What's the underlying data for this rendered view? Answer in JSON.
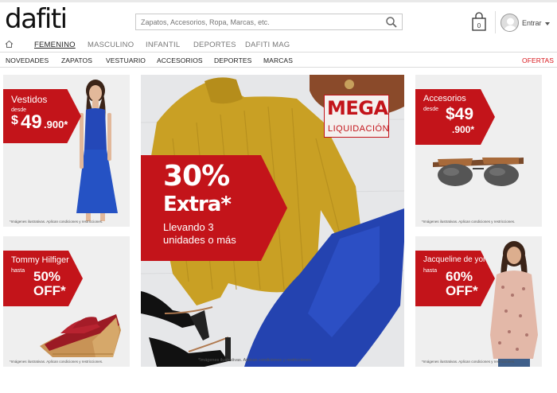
{
  "header": {
    "logo_text": "dafiti",
    "search_placeholder": "Zapatos, Accesorios, Ropa, Marcas, etc.",
    "search_icon": "search-icon",
    "cart_icon": "shopping-bag-icon",
    "cart_count": "0",
    "avatar_icon": "user-avatar-icon",
    "login_label": "Entrar"
  },
  "gender_nav": {
    "home_icon": "home-icon",
    "items": [
      {
        "label": "FEMENINO",
        "active": true
      },
      {
        "label": "MASCULINO"
      },
      {
        "label": "INFANTIL"
      },
      {
        "label": "DEPORTES"
      },
      {
        "label": "DAFITI MAG"
      }
    ]
  },
  "category_nav": {
    "items": [
      "NOVEDADES",
      "ZAPATOS",
      "VESTUARIO",
      "ACCESORIOS",
      "DEPORTES",
      "MARCAS"
    ],
    "offers": "OFERTAS"
  },
  "banners": {
    "dresses": {
      "line1": "Vestidos",
      "line2": "desde",
      "price_symbol": "$",
      "price": "49",
      "price_cents": ".900*",
      "disclaimer": "*Imágenes ilustrativas. Aplican condiciones y restricciones."
    },
    "accessories": {
      "line1": "Accesorios",
      "line2": "desde",
      "price": "$49",
      "price_cents": ".900*",
      "disclaimer": "*Imágenes ilustrativas. Aplican condiciones y restricciones."
    },
    "tommy": {
      "line1": "Tommy Hilfiger",
      "line2": "hasta",
      "percent": "50%",
      "off": "OFF*",
      "disclaimer": "*Imágenes ilustrativas. Aplican condiciones y restricciones."
    },
    "jacqueline": {
      "line1": "Jacqueline de yong",
      "line2": "hasta",
      "percent": "60%",
      "off": "OFF*",
      "disclaimer": "*Imágenes ilustrativas. Aplican condiciones y restricciones."
    },
    "main": {
      "mega_line1": "MEGA",
      "mega_line2": "LIQUIDACIÓN",
      "percent": "30%",
      "extra": "Extra*",
      "sub1": "Llevando 3",
      "sub2": "unidades o más",
      "disclaimer": "*Imágenes ilustrativas. Aplican condiciones y restricciones."
    }
  },
  "colors": {
    "brand_red": "#c3141a",
    "offers_red": "#d8161b",
    "sweater_mustard": "#c9a024",
    "pants_blue": "#2443b0"
  }
}
